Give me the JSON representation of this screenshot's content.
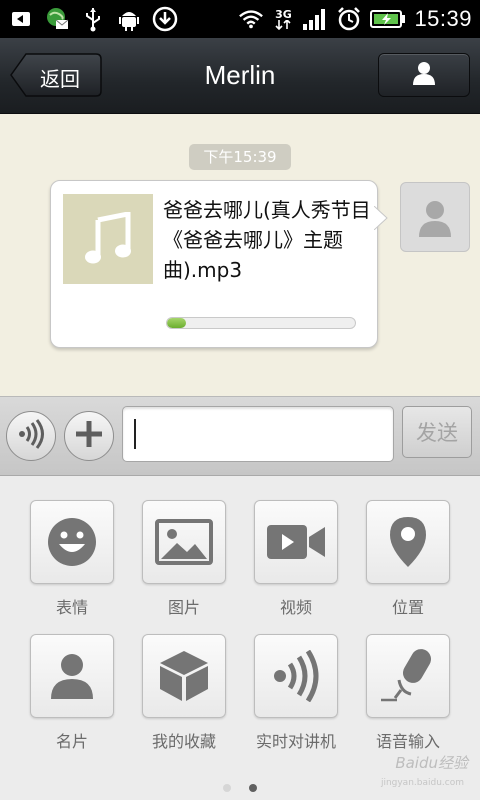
{
  "status_bar": {
    "time": "15:39",
    "network_label": "3G",
    "icons": [
      "back-arrow-icon",
      "map-mail-icon",
      "usb-icon",
      "android-debug-icon",
      "download-icon",
      "wifi-icon",
      "signal-icon",
      "alarm-icon",
      "battery-charging-icon"
    ]
  },
  "header": {
    "back_label": "返回",
    "title": "Merlin",
    "profile_icon": "person-icon"
  },
  "chat": {
    "timestamp": "下午15:39",
    "message": {
      "file_name": "爸爸去哪儿(真人秀节目《爸爸去哪儿》主题曲).mp3",
      "thumb_icon": "music-note-icon",
      "progress": 0.1
    },
    "avatar_icon": "default-avatar-icon"
  },
  "input_bar": {
    "voice_icon": "voice-icon",
    "add_icon": "plus-icon",
    "text_value": "",
    "send_label": "发送"
  },
  "tools": [
    {
      "label": "表情",
      "icon": "smiley-icon"
    },
    {
      "label": "图片",
      "icon": "image-icon"
    },
    {
      "label": "视频",
      "icon": "video-camera-icon"
    },
    {
      "label": "位置",
      "icon": "location-pin-icon"
    },
    {
      "label": "名片",
      "icon": "contact-card-icon"
    },
    {
      "label": "我的收藏",
      "icon": "favorites-cube-icon"
    },
    {
      "label": "实时对讲机",
      "icon": "walkie-talkie-icon"
    },
    {
      "label": "语音输入",
      "icon": "microphone-icon"
    }
  ],
  "pager": {
    "pages": 2,
    "current": 1
  },
  "watermark": {
    "text": "Baidu经验",
    "sub": "jingyan.baidu.com"
  },
  "colors": {
    "accent_green": "#7cbf3b",
    "chat_bg": "#f2efe1",
    "header_bg": "#22262a"
  }
}
